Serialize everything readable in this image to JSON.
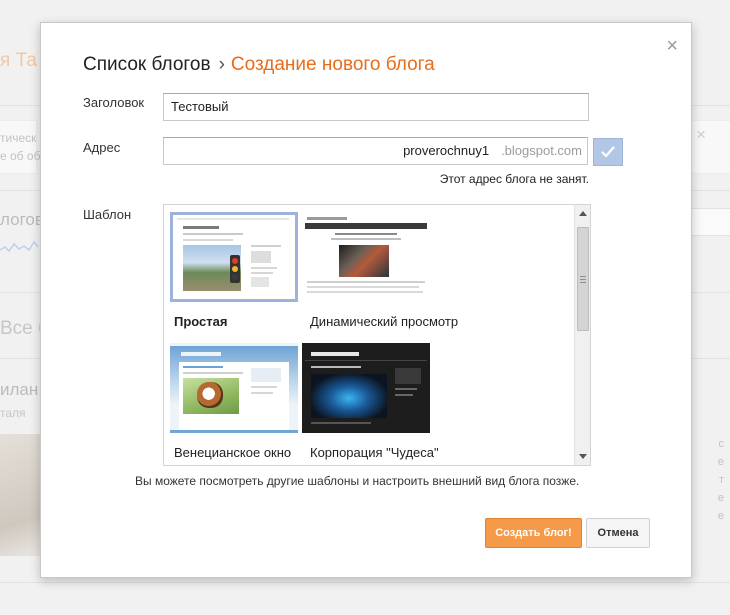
{
  "background": {
    "page_title": "я Та",
    "notice_line1": "тическ",
    "notice_line2": "е об об",
    "blogs_heading": "логов",
    "all_blogs": "Все б",
    "blog_name": "илан",
    "blog_author": "таля",
    "right_text": [
      "с",
      "е",
      "т",
      "е",
      "е"
    ]
  },
  "dialog": {
    "breadcrumb_root": "Список блогов",
    "breadcrumb_sep": "›",
    "breadcrumb_current": "Создание нового блога",
    "close_glyph": "×",
    "title_label": "Заголовок",
    "title_value": "Тестовый",
    "address_label": "Адрес",
    "address_value": "proverochnuy1",
    "address_suffix": ".blogspot.com",
    "address_status": "Этот адрес блога не занят.",
    "template_label": "Шаблон",
    "templates": [
      {
        "name": "Простая",
        "selected": true
      },
      {
        "name": "Динамический просмотр",
        "selected": false
      },
      {
        "name": "Венецианское окно",
        "selected": false
      },
      {
        "name": "Корпорация \"Чудеса\"",
        "selected": false
      }
    ],
    "hint": "Вы можете посмотреть другие шаблоны и настроить внешний вид блога позже.",
    "create_button": "Создать блог!",
    "cancel_button": "Отмена"
  },
  "colors": {
    "accent": "#e86c19",
    "create_button_bg": "#f59a48",
    "check_button_bg": "#b2c7e6",
    "selected_template_border": "#9db3dc"
  },
  "icons": {
    "close": "close-icon",
    "check": "check-icon",
    "scroll_up": "scroll-up-arrow-icon",
    "scroll_down": "scroll-down-arrow-icon"
  }
}
